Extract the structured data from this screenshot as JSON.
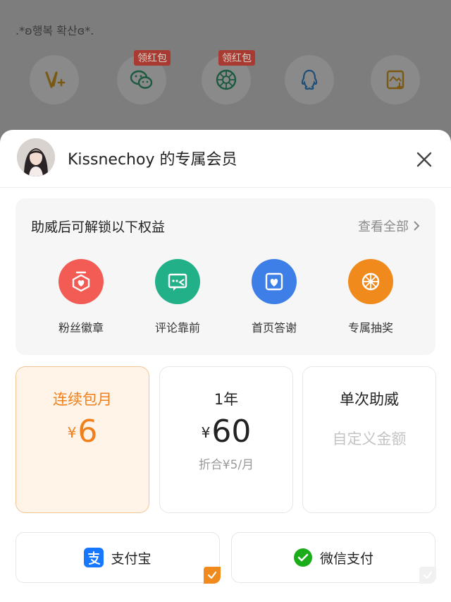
{
  "background": {
    "status_text": ".*ʚ행복 확산ɞ*.",
    "share_tag": "领红包",
    "share_icons": [
      "vlog-icon",
      "wechat-icon",
      "moments-icon",
      "qq-icon",
      "save-image-icon"
    ]
  },
  "sheet": {
    "title": "Kissnechoy 的专属会员",
    "close_icon": "close-icon"
  },
  "benefits": {
    "title": "助威后可解锁以下权益",
    "view_all": "查看全部",
    "items": [
      {
        "label": "粉丝徽章",
        "icon": "badge-icon",
        "color": "#f25c54"
      },
      {
        "label": "评论靠前",
        "icon": "comment-icon",
        "color": "#22b089"
      },
      {
        "label": "首页答谢",
        "icon": "thanks-icon",
        "color": "#3d7fe6"
      },
      {
        "label": "专属抽奖",
        "icon": "lottery-icon",
        "color": "#f08a1c"
      }
    ]
  },
  "plans": [
    {
      "name": "连续包月",
      "currency": "¥",
      "price": "6",
      "selected": true
    },
    {
      "name": "1年",
      "currency": "¥",
      "price": "60",
      "sub": "折合¥5/月",
      "selected": false
    },
    {
      "name": "单次助威",
      "custom": "自定义金额",
      "selected": false
    }
  ],
  "payment": {
    "alipay_label": "支付宝",
    "wechat_label": "微信支付",
    "selected": "alipay"
  },
  "colors": {
    "accent": "#f07f1c",
    "alipay_blue": "#1677ff",
    "wechat_green": "#1aad19"
  }
}
